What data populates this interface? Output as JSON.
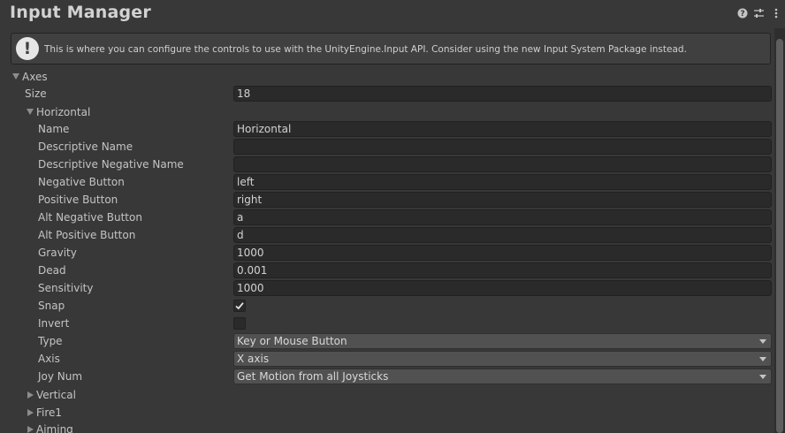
{
  "window": {
    "title": "Input Manager",
    "help_message": "This is where you can configure the controls to use with the UnityEngine.Input API. Consider using the new Input System Package instead.",
    "header_icons": [
      "help-icon",
      "preset-icon",
      "more-menu-icon"
    ]
  },
  "axes": {
    "label": "Axes",
    "size_label": "Size",
    "size_value": "18",
    "horizontal": {
      "label": "Horizontal",
      "fields": {
        "name": {
          "label": "Name",
          "value": "Horizontal"
        },
        "descriptive_name": {
          "label": "Descriptive Name",
          "value": ""
        },
        "descriptive_negative_name": {
          "label": "Descriptive Negative Name",
          "value": ""
        },
        "negative_button": {
          "label": "Negative Button",
          "value": "left"
        },
        "positive_button": {
          "label": "Positive Button",
          "value": "right"
        },
        "alt_negative_button": {
          "label": "Alt Negative Button",
          "value": "a"
        },
        "alt_positive_button": {
          "label": "Alt Positive Button",
          "value": "d"
        },
        "gravity": {
          "label": "Gravity",
          "value": "1000"
        },
        "dead": {
          "label": "Dead",
          "value": "0.001"
        },
        "sensitivity": {
          "label": "Sensitivity",
          "value": "1000"
        },
        "snap": {
          "label": "Snap",
          "checked": true
        },
        "invert": {
          "label": "Invert",
          "checked": false
        },
        "type": {
          "label": "Type",
          "value": "Key or Mouse Button"
        },
        "axis": {
          "label": "Axis",
          "value": "X axis"
        },
        "joy_num": {
          "label": "Joy Num",
          "value": "Get Motion from all Joysticks"
        }
      }
    },
    "collapsed": [
      {
        "label": "Vertical"
      },
      {
        "label": "Fire1"
      },
      {
        "label": "Aiming"
      }
    ]
  },
  "colors": {
    "background": "#383838",
    "field_bg": "#2a2a2a",
    "dropdown_bg": "#515151",
    "text": "#c4c4c4"
  }
}
